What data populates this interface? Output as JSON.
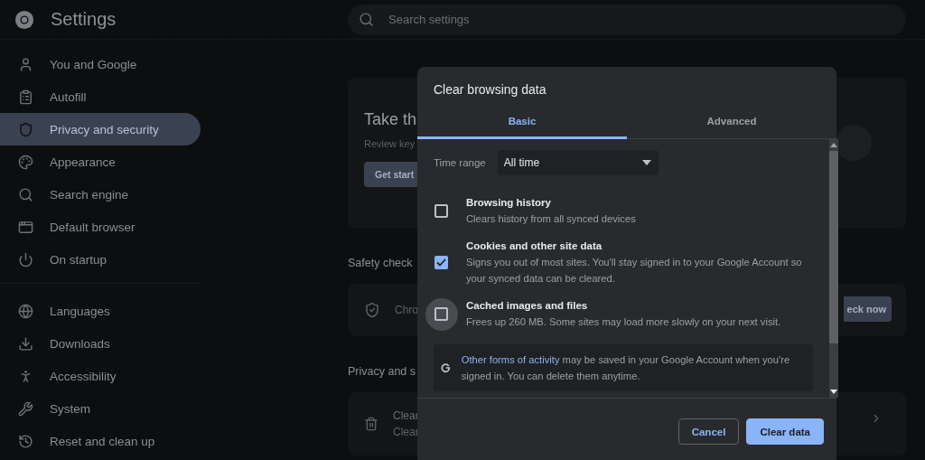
{
  "header": {
    "title": "Settings",
    "search": {
      "placeholder": "Search settings"
    }
  },
  "sidebar": {
    "groups": [
      [
        {
          "label": "You and Google",
          "selected": false
        },
        {
          "label": "Autofill",
          "selected": false
        },
        {
          "label": "Privacy and security",
          "selected": true
        },
        {
          "label": "Appearance",
          "selected": false
        },
        {
          "label": "Search engine",
          "selected": false
        },
        {
          "label": "Default browser",
          "selected": false
        },
        {
          "label": "On startup",
          "selected": false
        }
      ],
      [
        {
          "label": "Languages",
          "selected": false
        },
        {
          "label": "Downloads",
          "selected": false
        },
        {
          "label": "Accessibility",
          "selected": false
        },
        {
          "label": "System",
          "selected": false
        },
        {
          "label": "Reset and clean up",
          "selected": false
        }
      ]
    ]
  },
  "main": {
    "promo": {
      "title": "Take th",
      "text": "Review key",
      "button": "Get start"
    },
    "safety_check": {
      "heading": "Safety check",
      "row_text": "Chro",
      "button": "eck now"
    },
    "privacy": {
      "heading": "Privacy and s",
      "row_title": "Clear",
      "row_subtitle": "Clear"
    }
  },
  "dialog": {
    "title": "Clear browsing data",
    "tabs": [
      {
        "label": "Basic",
        "selected": true
      },
      {
        "label": "Advanced",
        "selected": false
      }
    ],
    "time_range": {
      "label": "Time range",
      "value": "All time"
    },
    "options": [
      {
        "title": "Browsing history",
        "description": "Clears history from all synced devices",
        "checked": false,
        "focused": false
      },
      {
        "title": "Cookies and other site data",
        "description": "Signs you out of most sites. You'll stay signed in to your Google Account so your synced data can be cleared.",
        "checked": true,
        "focused": false
      },
      {
        "title": "Cached images and files",
        "description": "Frees up 260 MB. Some sites may load more slowly on your next visit.",
        "checked": false,
        "focused": true
      }
    ],
    "notice": {
      "link": "Other forms of activity",
      "text": "may be saved in your Google Account when you're signed in. You can delete them anytime."
    },
    "buttons": [
      {
        "label": "Cancel",
        "kind": "secondary"
      },
      {
        "label": "Clear data",
        "kind": "primary"
      }
    ]
  }
}
